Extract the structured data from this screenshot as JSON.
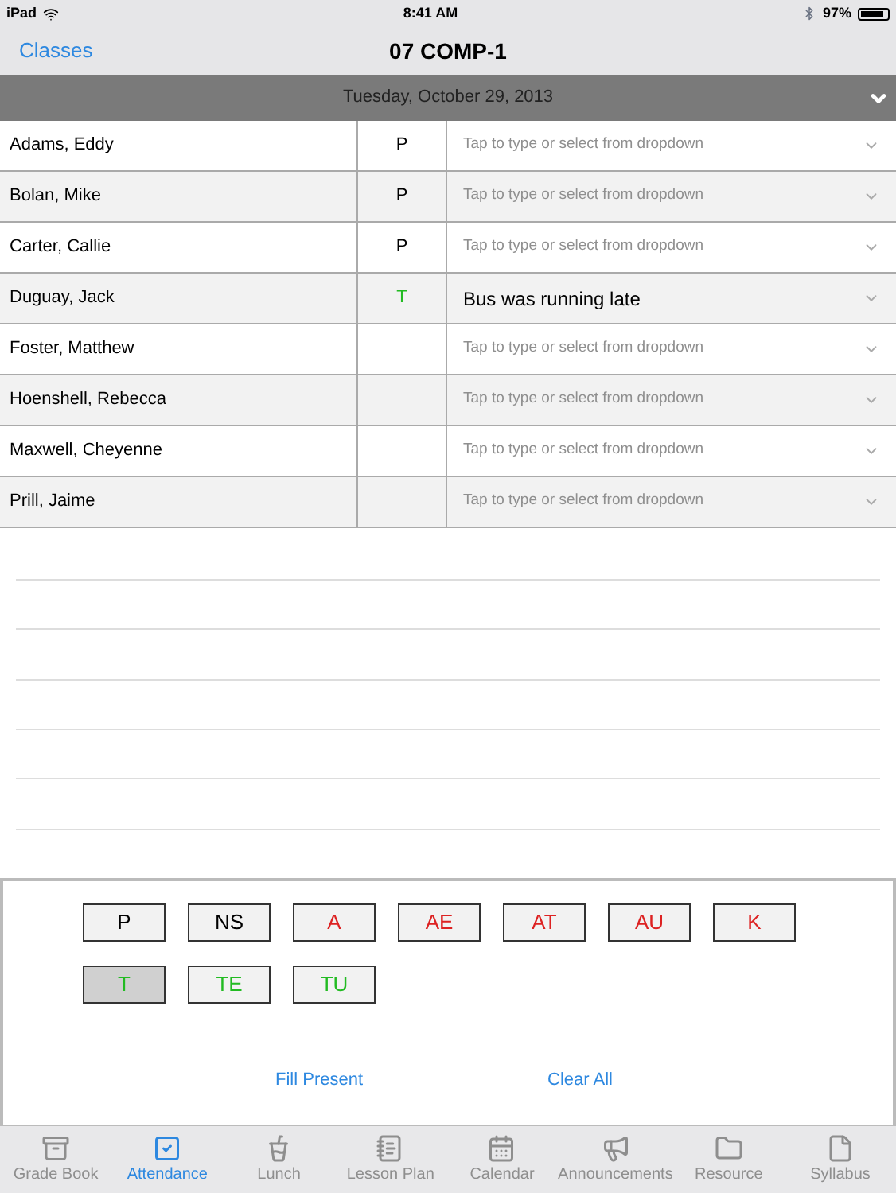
{
  "status_bar": {
    "device": "iPad",
    "time": "8:41 AM",
    "battery": "97%"
  },
  "nav": {
    "back": "Classes",
    "title": "07 COMP-1"
  },
  "date_bar": {
    "date": "Tuesday, October 29, 2013"
  },
  "rows": [
    {
      "name": "Adams, Eddy",
      "code": "P",
      "color": "#000000",
      "placeholder": "Tap to type or select from dropdown"
    },
    {
      "name": "Bolan, Mike",
      "code": "P",
      "color": "#000000",
      "placeholder": "Tap to type or select from dropdown"
    },
    {
      "name": "Carter, Callie",
      "code": "P",
      "color": "#000000",
      "placeholder": "Tap to type or select from dropdown"
    },
    {
      "name": "Duguay, Jack",
      "code": "T",
      "color": "#22bb22",
      "note": "Bus was running late"
    },
    {
      "name": "Foster, Matthew",
      "placeholder": "Tap to type or select from dropdown"
    },
    {
      "name": "Hoenshell, Rebecca",
      "placeholder": "Tap to type or select from dropdown"
    },
    {
      "name": "Maxwell, Cheyenne",
      "placeholder": "Tap to type or select from dropdown"
    },
    {
      "name": "Prill, Jaime",
      "placeholder": "Tap to type or select from dropdown"
    }
  ],
  "codes": [
    {
      "label": "P",
      "color": "#000000",
      "selected": false
    },
    {
      "label": "NS",
      "color": "#000000",
      "selected": false
    },
    {
      "label": "A",
      "color": "#dd2222",
      "selected": false
    },
    {
      "label": "AE",
      "color": "#dd2222",
      "selected": false
    },
    {
      "label": "AT",
      "color": "#dd2222",
      "selected": false
    },
    {
      "label": "AU",
      "color": "#dd2222",
      "selected": false
    },
    {
      "label": "K",
      "color": "#dd2222",
      "selected": false
    },
    {
      "label": "T",
      "color": "#22bb22",
      "selected": true
    },
    {
      "label": "TE",
      "color": "#22bb22",
      "selected": false
    },
    {
      "label": "TU",
      "color": "#22bb22",
      "selected": false
    }
  ],
  "actions": [
    "Fill Present",
    "Clear All"
  ],
  "tabs": [
    {
      "label": "Grade Book",
      "kind": "gradebook",
      "selected": false
    },
    {
      "label": "Attendance",
      "kind": "attendance",
      "selected": true
    },
    {
      "label": "Lunch",
      "kind": "lunch",
      "selected": false
    },
    {
      "label": "Lesson Plan",
      "kind": "lessonplan",
      "selected": false
    },
    {
      "label": "Calendar",
      "kind": "calendar",
      "selected": false
    },
    {
      "label": "Announcements",
      "kind": "announcements",
      "selected": false
    },
    {
      "label": "Resource",
      "kind": "resource",
      "selected": false
    },
    {
      "label": "Syllabus",
      "kind": "syllabus",
      "selected": false
    }
  ]
}
